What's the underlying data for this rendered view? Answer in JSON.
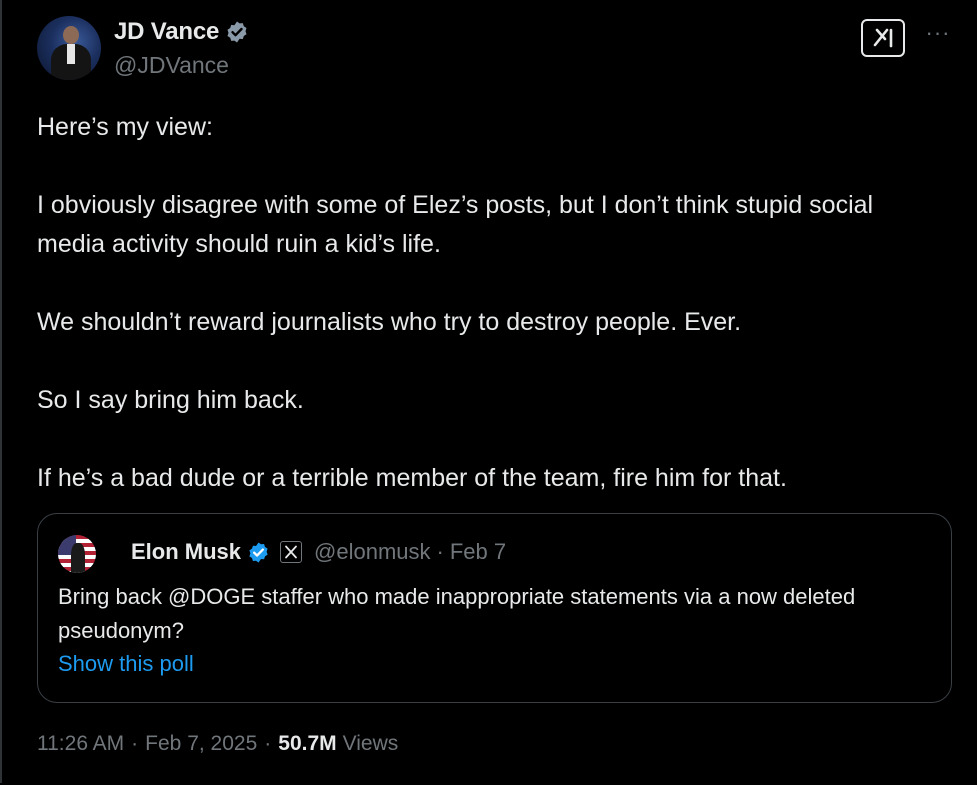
{
  "author": {
    "display_name": "JD Vance",
    "handle": "@JDVance",
    "verified_icon": "verified-badge-icon",
    "avatar_icon": "avatar"
  },
  "header_actions": {
    "grok_icon": "grok-icon",
    "more_icon": "more-icon",
    "more_label": "···"
  },
  "tweet": {
    "paragraphs": [
      "Here’s my view:",
      "I obviously disagree with some of Elez’s posts, but I don’t think stupid social media activity should ruin a kid’s life.",
      "We shouldn’t reward journalists who try to destroy people. Ever.",
      "So I say bring him back.",
      "If he’s a bad dude or a terrible member of the team, fire him for that."
    ]
  },
  "quote": {
    "display_name": "Elon Musk",
    "handle": "@elonmusk",
    "separator": "·",
    "date": "Feb 7",
    "text": "Bring back @DOGE staffer who made inappropriate statements via a now deleted pseudonym?",
    "poll_link": "Show this poll",
    "x_badge_icon": "x-logo-icon"
  },
  "meta": {
    "time": "11:26 AM",
    "separator": "·",
    "date": "Feb 7, 2025",
    "views_count": "50.7M",
    "views_label": "Views"
  },
  "colors": {
    "background": "#000000",
    "text_primary": "#e7e9ea",
    "text_secondary": "#71767b",
    "link": "#1d9bf0",
    "verified": "#1d9bf0",
    "border": "#2f3336"
  }
}
